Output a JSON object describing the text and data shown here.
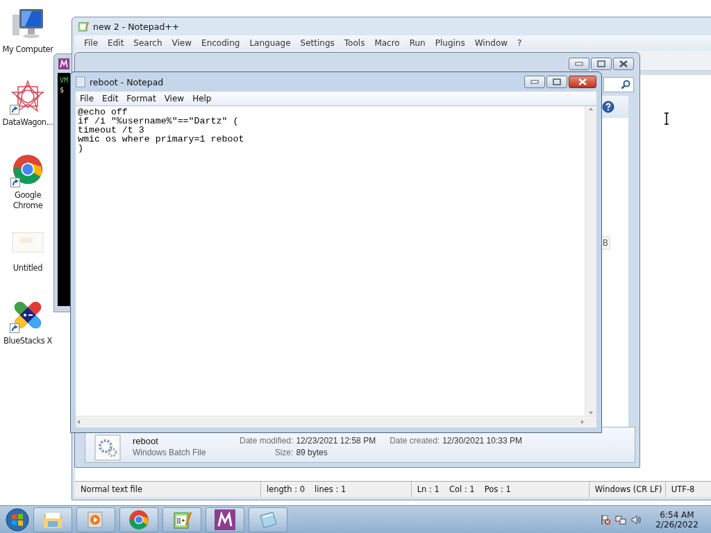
{
  "desktop_icons": [
    {
      "label": "My Computer",
      "kind": "computer",
      "shortcut": false
    },
    {
      "label": "DataWagon...",
      "kind": "star",
      "shortcut": true
    },
    {
      "label": "Google Chrome",
      "kind": "chrome",
      "shortcut": true
    },
    {
      "label": "Untitled",
      "kind": "blank",
      "shortcut": false
    },
    {
      "label": "BlueStacks X",
      "kind": "bluestacks",
      "shortcut": true
    }
  ],
  "terminal": {
    "lines": [
      "VM",
      "$"
    ]
  },
  "notepadpp": {
    "title": "new 2 - Notepad++",
    "menu": [
      "File",
      "Edit",
      "Search",
      "View",
      "Encoding",
      "Language",
      "Settings",
      "Tools",
      "Macro",
      "Run",
      "Plugins",
      "Window",
      "?"
    ],
    "status_bar": [
      [
        "Normal text file"
      ],
      [
        "length : 0",
        "lines : 1"
      ],
      [
        "Ln : 1",
        "Col : 1",
        "Pos : 1"
      ],
      [
        "Windows (CR LF)"
      ],
      [
        "UTF-8"
      ]
    ]
  },
  "explorer": {
    "partial_label": "B",
    "details": {
      "name": "reboot",
      "type": "Windows Batch File",
      "fields": [
        {
          "label": "Date modified:",
          "value": "12/23/2021 12:58 PM"
        },
        {
          "label": "Date created:",
          "value": "12/30/2021 10:33 PM"
        },
        {
          "label": "Size:",
          "value": "89 bytes"
        }
      ]
    }
  },
  "notepad": {
    "title": "reboot - Notepad",
    "menu": [
      "File",
      "Edit",
      "Format",
      "View",
      "Help"
    ],
    "lines": [
      "@echo off",
      "if /i \"%username%\"==\"Dartz\" (",
      "timeout /t 3",
      "wmic os where primary=1 reboot",
      ")"
    ]
  },
  "taskbar": {
    "apps": [
      {
        "kind": "folder"
      },
      {
        "kind": "media"
      },
      {
        "kind": "chrome"
      },
      {
        "kind": "notepadpp"
      },
      {
        "kind": "m"
      },
      {
        "kind": "notepad"
      }
    ],
    "clock": {
      "time": "6:54 AM",
      "date": "2/26/2022"
    }
  }
}
